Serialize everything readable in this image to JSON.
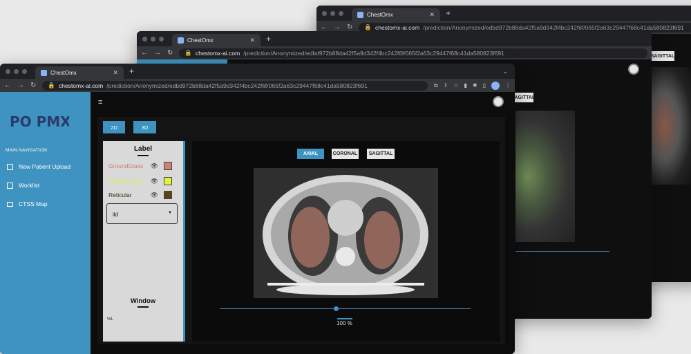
{
  "browser": {
    "tab_title": "ChestOmx",
    "url_host": "chestomx-ai.com",
    "url_path": "/prediction/Anonymized/edbd972b88da42f5a9d342f4bc242f6f/065f2a63c29447f68c41da580823f691"
  },
  "sidebar": {
    "logo_text": "PO PMX",
    "section_heading": "MAIN NAVIGATION",
    "items": [
      {
        "label": "New Patient Upload",
        "icon": "upload-icon"
      },
      {
        "label": "Worklist",
        "icon": "grid-icon"
      },
      {
        "label": "CTSS Map",
        "icon": "card-icon"
      }
    ]
  },
  "toolbar": {
    "btn_2d": "2D",
    "btn_3d": "3D"
  },
  "labels": {
    "title": "Label",
    "items": [
      {
        "name": "GroundGlass",
        "color": "#cd8273",
        "text_color": "#cf7d6b"
      },
      {
        "name": "HoneyComb",
        "color": "#e1f039",
        "text_color": "#e1f039"
      },
      {
        "name": "Reticular",
        "color": "#5a4612",
        "text_color": "#3b2d10"
      }
    ],
    "dropdown_value": "ild",
    "window_title": "Window",
    "wl_label": "WL"
  },
  "viewer": {
    "views": [
      "AXIAL",
      "CORONAL",
      "SAGITTAL"
    ],
    "active_view": "AXIAL",
    "zoom_label": "100 %",
    "slice_position": 0.46
  },
  "colors": {
    "accent": "#3f93c1",
    "sidebar": "#3f93c1",
    "background": "#0c0c0c"
  }
}
